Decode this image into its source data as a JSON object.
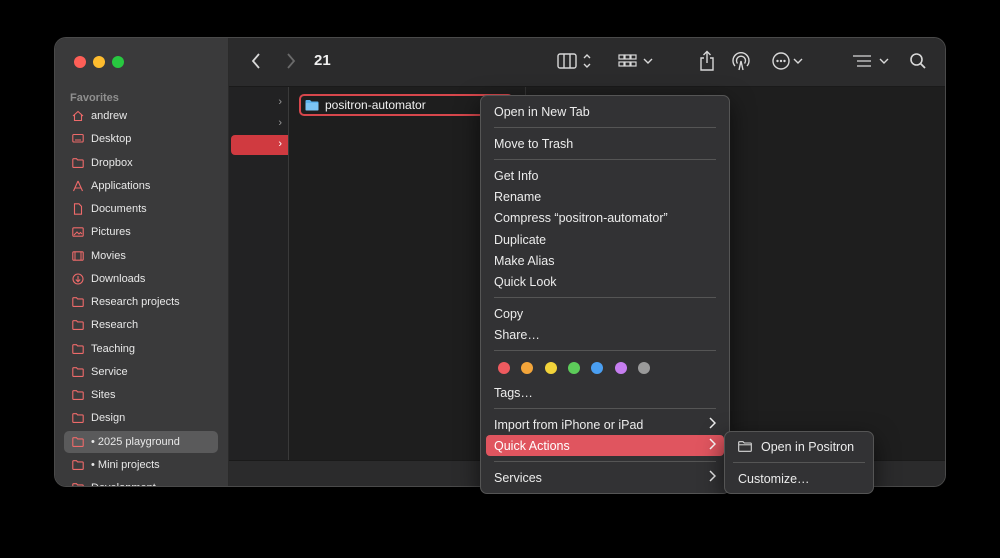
{
  "window": {
    "title": "21"
  },
  "sidebar": {
    "heading": "Favorites",
    "items": [
      {
        "label": "andrew",
        "icon": "home-icon"
      },
      {
        "label": "Desktop",
        "icon": "desktop-icon"
      },
      {
        "label": "Dropbox",
        "icon": "folder-icon"
      },
      {
        "label": "Applications",
        "icon": "applications-icon"
      },
      {
        "label": "Documents",
        "icon": "document-icon"
      },
      {
        "label": "Pictures",
        "icon": "photo-icon"
      },
      {
        "label": "Movies",
        "icon": "film-icon"
      },
      {
        "label": "Downloads",
        "icon": "download-icon"
      },
      {
        "label": "Research projects",
        "icon": "folder-icon"
      },
      {
        "label": "Research",
        "icon": "folder-icon"
      },
      {
        "label": "Teaching",
        "icon": "folder-icon"
      },
      {
        "label": "Service",
        "icon": "folder-icon"
      },
      {
        "label": "Sites",
        "icon": "folder-icon"
      },
      {
        "label": "Design",
        "icon": "folder-icon"
      },
      {
        "label": "• 2025 playground",
        "icon": "folder-icon",
        "selected": true
      },
      {
        "label": "• Mini projects",
        "icon": "folder-icon"
      },
      {
        "label": "Development",
        "icon": "folder-icon"
      }
    ]
  },
  "browser": {
    "selected_item": "positron-automator"
  },
  "context_menu": {
    "items": [
      {
        "label": "Open in New Tab"
      },
      {
        "label": "Move to Trash"
      },
      {
        "label": "Get Info"
      },
      {
        "label": "Rename"
      },
      {
        "label": "Compress “positron-automator”"
      },
      {
        "label": "Duplicate"
      },
      {
        "label": "Make Alias"
      },
      {
        "label": "Quick Look"
      },
      {
        "label": "Copy"
      },
      {
        "label": "Share…"
      },
      {
        "label": "Tags…"
      },
      {
        "label": "Import from iPhone or iPad"
      },
      {
        "label": "Quick Actions"
      },
      {
        "label": "Services"
      }
    ],
    "tag_colors": [
      "#ee5a5f",
      "#f3a53a",
      "#f2d33a",
      "#5dcc5a",
      "#4a9ff2",
      "#c67ef0",
      "#9a9a9a"
    ]
  },
  "submenu": {
    "items": [
      {
        "label": "Open in Positron",
        "icon": "folder-icon"
      },
      {
        "label": "Customize…"
      }
    ]
  },
  "colors": {
    "accent": "#e0555f",
    "selection_border": "#d7474c"
  }
}
